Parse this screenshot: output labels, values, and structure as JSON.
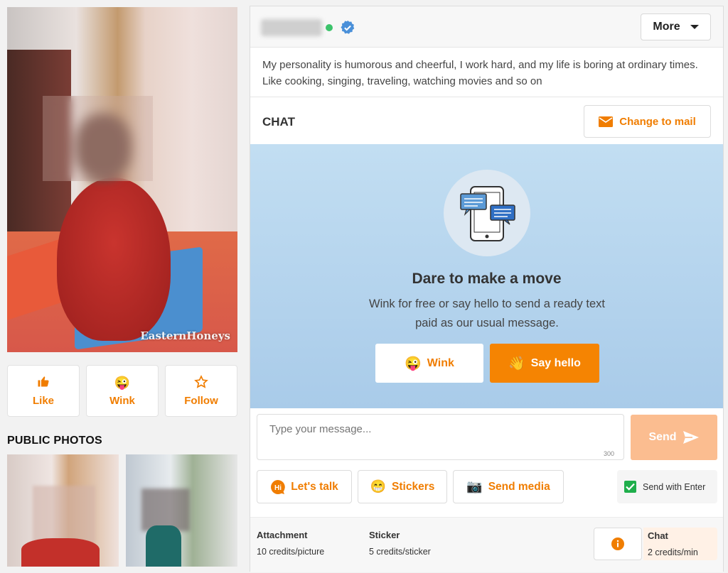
{
  "profile": {
    "photo_watermark": "EasternHoneys",
    "actions": [
      {
        "label": "Like",
        "icon": "thumbs-up-icon"
      },
      {
        "label": "Wink",
        "icon": "wink-emoji-icon"
      },
      {
        "label": "Follow",
        "icon": "star-icon"
      }
    ],
    "public_photos_title": "PUBLIC PHOTOS"
  },
  "header": {
    "more_label": "More",
    "online_color": "#3cc36b",
    "verified_color": "#4a90d9"
  },
  "bio": "My personality is humorous and cheerful, I work hard, and my life is boring at ordinary times. Like cooking, singing, traveling, watching movies and so on",
  "chat": {
    "title": "CHAT",
    "change_to_mail": "Change to mail"
  },
  "hero": {
    "title": "Dare to make a move",
    "subtitle": "Wink for free or say hello to send a ready text paid as our usual message.",
    "wink_label": "Wink",
    "say_hello_label": "Say hello"
  },
  "composer": {
    "placeholder": "Type your message...",
    "char_limit": "300",
    "send_label": "Send"
  },
  "tools": {
    "lets_talk": "Let's talk",
    "stickers": "Stickers",
    "send_media": "Send media",
    "send_with_enter": "Send with Enter",
    "send_with_enter_checked": true
  },
  "pricing": {
    "attachment_title": "Attachment",
    "attachment_price": "10 credits/picture",
    "sticker_title": "Sticker",
    "sticker_price": "5 credits/sticker",
    "chat_title": "Chat",
    "chat_price": "2 credits/min"
  },
  "colors": {
    "accent": "#f07d00",
    "send_disabled": "#fbbd90",
    "hero_bg": "#b6d4ed"
  }
}
